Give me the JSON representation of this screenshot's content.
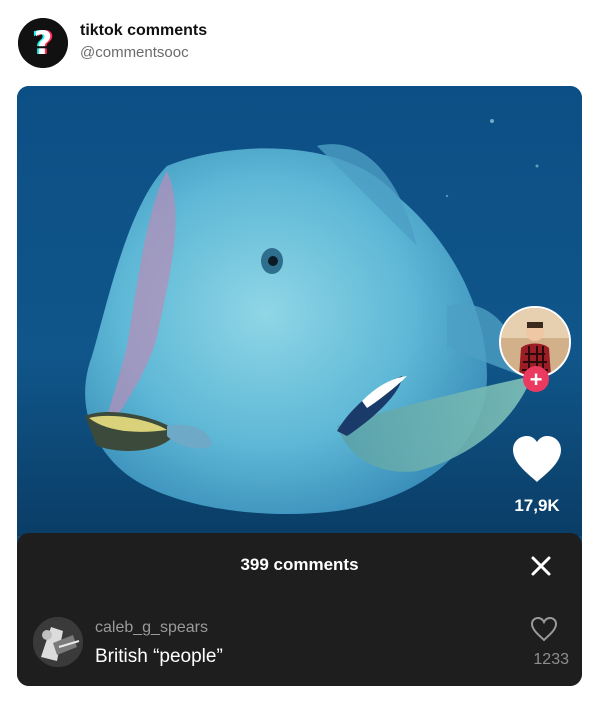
{
  "account": {
    "name": "tiktok comments",
    "handle": "@commentsooc",
    "logo_icon": "question-mark-logo-icon"
  },
  "video": {
    "subject": "fish-photo",
    "likes": "17,9K",
    "follow_icon": "plus-icon",
    "like_icon": "heart-icon"
  },
  "comments_sheet": {
    "title": "399 comments",
    "close_icon": "close-icon",
    "comment": {
      "username": "caleb_g_spears",
      "text": "British “people”",
      "likes": "1233",
      "like_icon": "heart-outline-icon"
    }
  },
  "colors": {
    "sheet_bg": "#1e1e1e",
    "follow_red": "#ea3a60",
    "water_blue": "#0f4a78"
  }
}
